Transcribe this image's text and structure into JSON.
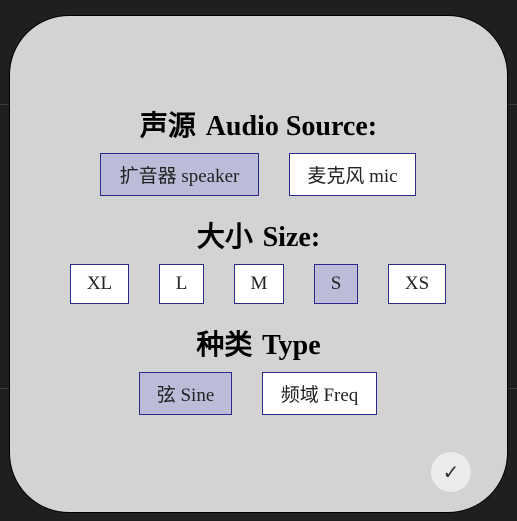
{
  "source": {
    "heading_cjk": "声源",
    "heading_latin": "Audio Source:",
    "options": [
      {
        "label": "扩音器 speaker",
        "selected": true
      },
      {
        "label": "麦克风 mic",
        "selected": false
      }
    ]
  },
  "size": {
    "heading_cjk": "大小",
    "heading_latin": "Size:",
    "options": [
      {
        "label": "XL",
        "selected": false
      },
      {
        "label": "L",
        "selected": false
      },
      {
        "label": "M",
        "selected": false
      },
      {
        "label": "S",
        "selected": true
      },
      {
        "label": "XS",
        "selected": false
      }
    ]
  },
  "type": {
    "heading_cjk": "种类",
    "heading_latin": "Type",
    "options": [
      {
        "label": "弦 Sine",
        "selected": true
      },
      {
        "label": "频域 Freq",
        "selected": false
      }
    ]
  },
  "confirm": {
    "icon": "check-icon",
    "glyph": "✓"
  },
  "colors": {
    "panel_bg": "#d3d3d3",
    "selected_bg": "#bcbcd9",
    "button_border": "#2a2a8a"
  }
}
